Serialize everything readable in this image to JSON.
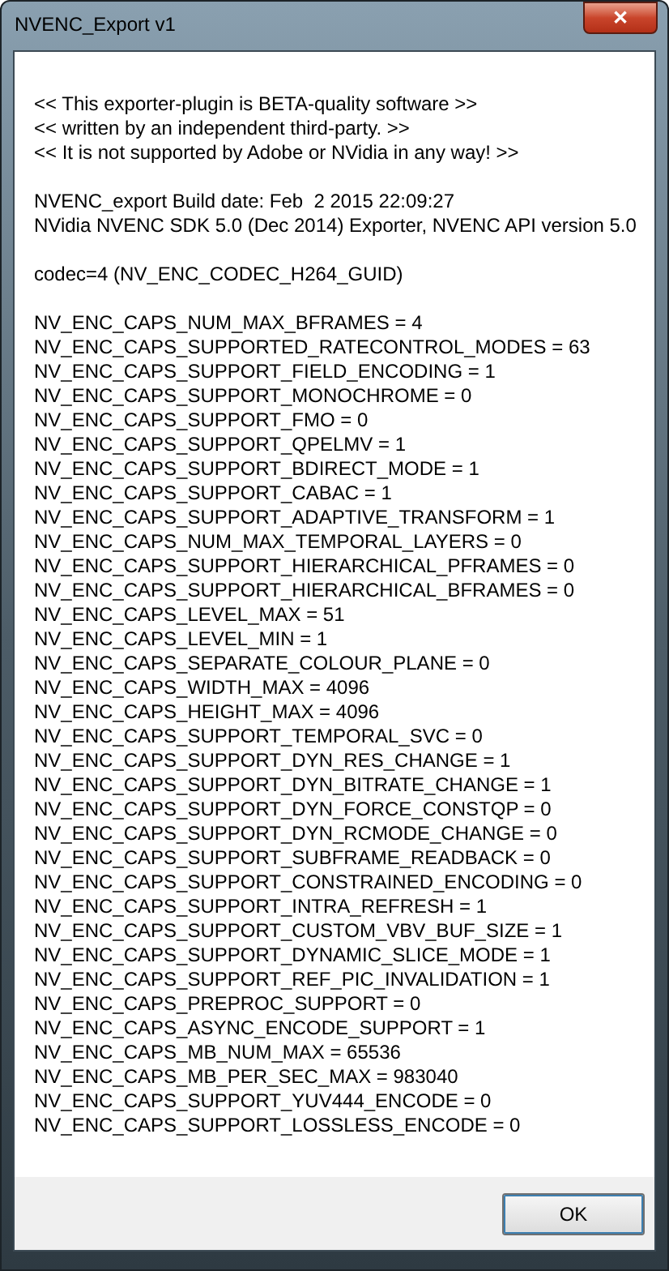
{
  "window": {
    "title": "NVENC_Export v1",
    "close_button": "✕"
  },
  "paragraphs": [
    [
      "<< This exporter-plugin is BETA-quality software >>",
      "<< written by an independent third-party. >>",
      "<< It is not supported by Adobe or NVidia in any way! >>"
    ],
    [
      "NVENC_export Build date: Feb  2 2015 22:09:27",
      "NVidia NVENC SDK 5.0 (Dec 2014) Exporter, NVENC API version 5.0"
    ],
    [
      "codec=4 (NV_ENC_CODEC_H264_GUID)"
    ],
    [
      "NV_ENC_CAPS_NUM_MAX_BFRAMES = 4",
      "NV_ENC_CAPS_SUPPORTED_RATECONTROL_MODES = 63",
      "NV_ENC_CAPS_SUPPORT_FIELD_ENCODING = 1",
      "NV_ENC_CAPS_SUPPORT_MONOCHROME = 0",
      "NV_ENC_CAPS_SUPPORT_FMO = 0",
      "NV_ENC_CAPS_SUPPORT_QPELMV = 1",
      "NV_ENC_CAPS_SUPPORT_BDIRECT_MODE = 1",
      "NV_ENC_CAPS_SUPPORT_CABAC = 1",
      "NV_ENC_CAPS_SUPPORT_ADAPTIVE_TRANSFORM = 1",
      "NV_ENC_CAPS_NUM_MAX_TEMPORAL_LAYERS = 0",
      "NV_ENC_CAPS_SUPPORT_HIERARCHICAL_PFRAMES = 0",
      "NV_ENC_CAPS_SUPPORT_HIERARCHICAL_BFRAMES = 0",
      "NV_ENC_CAPS_LEVEL_MAX = 51",
      "NV_ENC_CAPS_LEVEL_MIN = 1",
      "NV_ENC_CAPS_SEPARATE_COLOUR_PLANE = 0",
      "NV_ENC_CAPS_WIDTH_MAX = 4096",
      "NV_ENC_CAPS_HEIGHT_MAX = 4096",
      "NV_ENC_CAPS_SUPPORT_TEMPORAL_SVC = 0",
      "NV_ENC_CAPS_SUPPORT_DYN_RES_CHANGE = 1",
      "NV_ENC_CAPS_SUPPORT_DYN_BITRATE_CHANGE = 1",
      "NV_ENC_CAPS_SUPPORT_DYN_FORCE_CONSTQP = 0",
      "NV_ENC_CAPS_SUPPORT_DYN_RCMODE_CHANGE = 0",
      "NV_ENC_CAPS_SUPPORT_SUBFRAME_READBACK = 0",
      "NV_ENC_CAPS_SUPPORT_CONSTRAINED_ENCODING = 0",
      "NV_ENC_CAPS_SUPPORT_INTRA_REFRESH = 1",
      "NV_ENC_CAPS_SUPPORT_CUSTOM_VBV_BUF_SIZE = 1",
      "NV_ENC_CAPS_SUPPORT_DYNAMIC_SLICE_MODE = 1",
      "NV_ENC_CAPS_SUPPORT_REF_PIC_INVALIDATION = 1",
      "NV_ENC_CAPS_PREPROC_SUPPORT = 0",
      "NV_ENC_CAPS_ASYNC_ENCODE_SUPPORT = 1",
      "NV_ENC_CAPS_MB_NUM_MAX = 65536",
      "NV_ENC_CAPS_MB_PER_SEC_MAX = 983040",
      "NV_ENC_CAPS_SUPPORT_YUV444_ENCODE = 0",
      "NV_ENC_CAPS_SUPPORT_LOSSLESS_ENCODE = 0"
    ]
  ],
  "buttons": [
    "OK"
  ]
}
